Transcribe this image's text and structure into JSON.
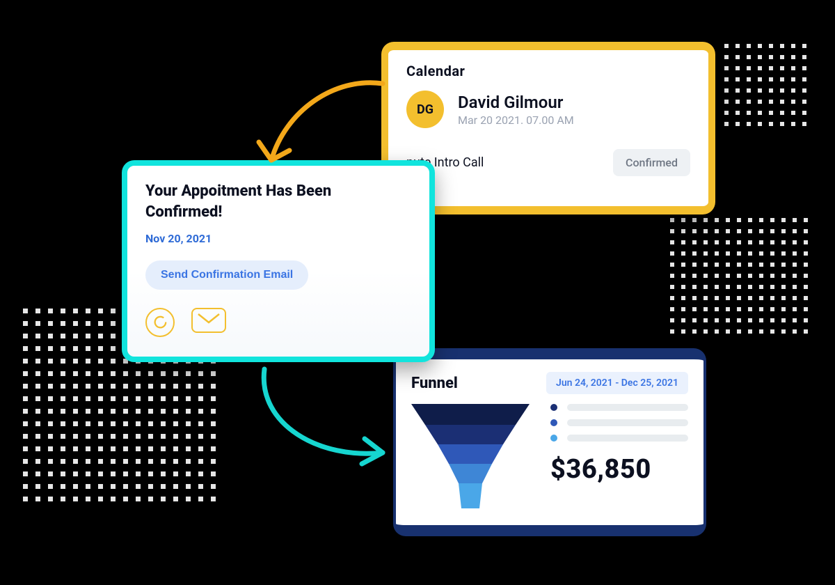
{
  "calendar": {
    "title": "Calendar",
    "avatar_initials": "DG",
    "name": "David Gilmour",
    "datetime": "Mar 20 2021. 07.00 AM",
    "event_label": "nute Intro Call",
    "status": "Confirmed"
  },
  "appointment": {
    "title": "Your Appoitment Has Been Confirmed!",
    "date": "Nov 20, 2021",
    "button": "Send Confirmation Email"
  },
  "funnel": {
    "title": "Funnel",
    "date_range": "Jun 24, 2021 -  Dec 25, 2021",
    "value": "$36,850",
    "legend_colors": [
      "#1b2f74",
      "#2f58b8",
      "#4aa7e8"
    ]
  },
  "chart_data": {
    "type": "funnel",
    "title": "Funnel",
    "stages": [
      {
        "color": "#0f1d4a",
        "width_pct": 100
      },
      {
        "color": "#1b2f74",
        "width_pct": 82
      },
      {
        "color": "#2f58b8",
        "width_pct": 64
      },
      {
        "color": "#3e86d6",
        "width_pct": 46
      },
      {
        "color": "#4aa7e8",
        "width_pct": 28
      }
    ],
    "total_value_label": "$36,850",
    "date_range": "Jun 24, 2021 - Dec 25, 2021"
  }
}
